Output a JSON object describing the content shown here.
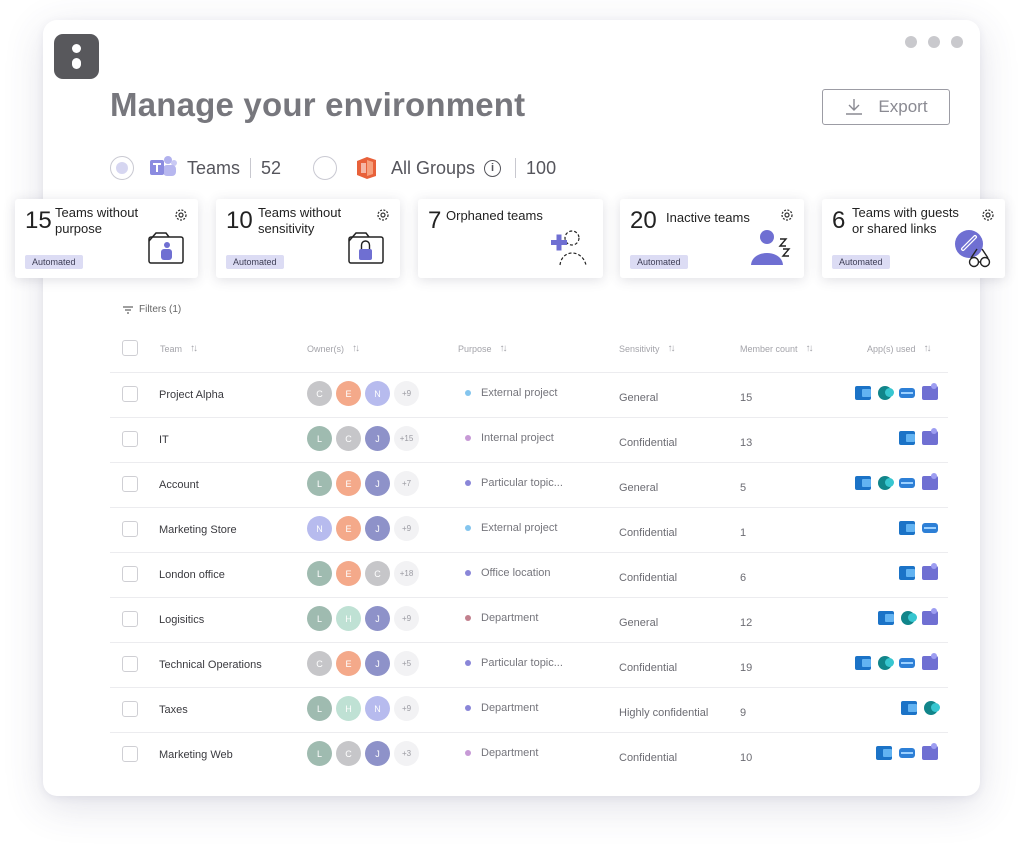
{
  "page": {
    "title": "Manage your environment",
    "export_label": "Export"
  },
  "scopes": [
    {
      "label": "Teams",
      "count": "52",
      "selected": true
    },
    {
      "label": "All Groups",
      "count": "100",
      "selected": false
    }
  ],
  "cards": [
    {
      "num": "15",
      "title": "Teams without purpose",
      "badge": "Automated"
    },
    {
      "num": "10",
      "title": "Teams without sensitivity",
      "badge": "Automated"
    },
    {
      "num": "7",
      "title": "Orphaned teams",
      "badge": ""
    },
    {
      "num": "20",
      "title": "Inactive teams",
      "badge": "Automated"
    },
    {
      "num": "6",
      "title": "Teams with guests or shared links",
      "badge": "Automated"
    }
  ],
  "filters_label": "Filters (1)",
  "columns": [
    "Team",
    "Owner(s)",
    "Purpose",
    "Sensitivity",
    "Member count",
    "App(s) used"
  ],
  "colors": {
    "teal": "#9fbbb0",
    "orange": "#f4a98a",
    "lavender": "#b7bbee",
    "grey": "#c6c6c9",
    "slate": "#8e92c9",
    "mint": "#bfe1d4",
    "purpose_blue": "#84c5ee",
    "purpose_purple": "#c79ad6",
    "purpose_indigo": "#8a86d8",
    "purpose_rose": "#c2808e"
  },
  "rows": [
    {
      "team": "Project Alpha",
      "owners": [
        {
          "i": "C",
          "c": "grey"
        },
        {
          "i": "E",
          "c": "orange"
        },
        {
          "i": "N",
          "c": "lavender"
        }
      ],
      "more": "+9",
      "purpose": "External project",
      "pcolor": "purpose_blue",
      "sensitivity": "General",
      "members": "15",
      "apps": [
        "outlook",
        "sharepoint",
        "exchange",
        "teams"
      ]
    },
    {
      "team": "IT",
      "owners": [
        {
          "i": "L",
          "c": "teal"
        },
        {
          "i": "C",
          "c": "grey"
        },
        {
          "i": "J",
          "c": "slate"
        }
      ],
      "more": "+15",
      "purpose": "Internal project",
      "pcolor": "purpose_purple",
      "sensitivity": "Confidential",
      "members": "13",
      "apps": [
        "outlook",
        "teams"
      ]
    },
    {
      "team": "Account",
      "owners": [
        {
          "i": "L",
          "c": "teal"
        },
        {
          "i": "E",
          "c": "orange"
        },
        {
          "i": "J",
          "c": "slate"
        }
      ],
      "more": "+7",
      "purpose": "Particular topic...",
      "pcolor": "purpose_indigo",
      "sensitivity": "General",
      "members": "5",
      "apps": [
        "outlook",
        "sharepoint",
        "exchange",
        "teams"
      ]
    },
    {
      "team": "Marketing Store",
      "owners": [
        {
          "i": "N",
          "c": "lavender"
        },
        {
          "i": "E",
          "c": "orange"
        },
        {
          "i": "J",
          "c": "slate"
        }
      ],
      "more": "+9",
      "purpose": "External project",
      "pcolor": "purpose_blue",
      "sensitivity": "Confidential",
      "members": "1",
      "apps": [
        "outlook",
        "exchange"
      ]
    },
    {
      "team": "London office",
      "owners": [
        {
          "i": "L",
          "c": "teal"
        },
        {
          "i": "E",
          "c": "orange"
        },
        {
          "i": "C",
          "c": "grey"
        }
      ],
      "more": "+18",
      "purpose": "Office location",
      "pcolor": "purpose_indigo",
      "sensitivity": "Confidential",
      "members": "6",
      "apps": [
        "outlook",
        "teams"
      ]
    },
    {
      "team": "Logisitics",
      "owners": [
        {
          "i": "L",
          "c": "teal"
        },
        {
          "i": "H",
          "c": "mint"
        },
        {
          "i": "J",
          "c": "slate"
        }
      ],
      "more": "+9",
      "purpose": "Department",
      "pcolor": "purpose_rose",
      "sensitivity": "General",
      "members": "12",
      "apps": [
        "outlook",
        "sharepoint",
        "teams"
      ]
    },
    {
      "team": "Technical Operations",
      "owners": [
        {
          "i": "C",
          "c": "grey"
        },
        {
          "i": "E",
          "c": "orange"
        },
        {
          "i": "J",
          "c": "slate"
        }
      ],
      "more": "+5",
      "purpose": "Particular topic...",
      "pcolor": "purpose_indigo",
      "sensitivity": "Confidential",
      "members": "19",
      "apps": [
        "outlook",
        "sharepoint",
        "exchange",
        "teams"
      ]
    },
    {
      "team": "Taxes",
      "owners": [
        {
          "i": "L",
          "c": "teal"
        },
        {
          "i": "H",
          "c": "mint"
        },
        {
          "i": "N",
          "c": "lavender"
        }
      ],
      "more": "+9",
      "purpose": "Department",
      "pcolor": "purpose_indigo",
      "sensitivity": "Highly confidential",
      "members": "9",
      "apps": [
        "outlook",
        "sharepoint"
      ]
    },
    {
      "team": "Marketing Web",
      "owners": [
        {
          "i": "L",
          "c": "teal"
        },
        {
          "i": "C",
          "c": "grey"
        },
        {
          "i": "J",
          "c": "slate"
        }
      ],
      "more": "+3",
      "purpose": "Department",
      "pcolor": "purpose_purple",
      "sensitivity": "Confidential",
      "members": "10",
      "apps": [
        "outlook",
        "exchange",
        "teams"
      ]
    }
  ]
}
